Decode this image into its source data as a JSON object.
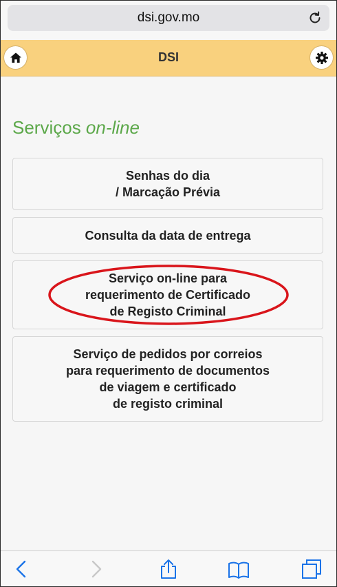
{
  "browser": {
    "url": "dsi.gov.mo"
  },
  "header": {
    "title": "DSI"
  },
  "content": {
    "section_title_prefix": "Serviços ",
    "section_title_emphasis": "on-line",
    "cards": [
      {
        "label": "Senhas do dia\n/ Marcação Prévia"
      },
      {
        "label": "Consulta da data de entrega"
      },
      {
        "label": "Serviço on-line para\nrequerimento de Certificado\nde Registo Criminal"
      },
      {
        "label": "Serviço de pedidos por correios\npara requerimento de documentos\nde viagem e certificado\nde registo criminal"
      }
    ],
    "highlight_color": "#d9151b"
  },
  "colors": {
    "header_bg": "#f9d17e",
    "accent_green": "#5ca84a",
    "ios_blue": "#1a73e8"
  }
}
